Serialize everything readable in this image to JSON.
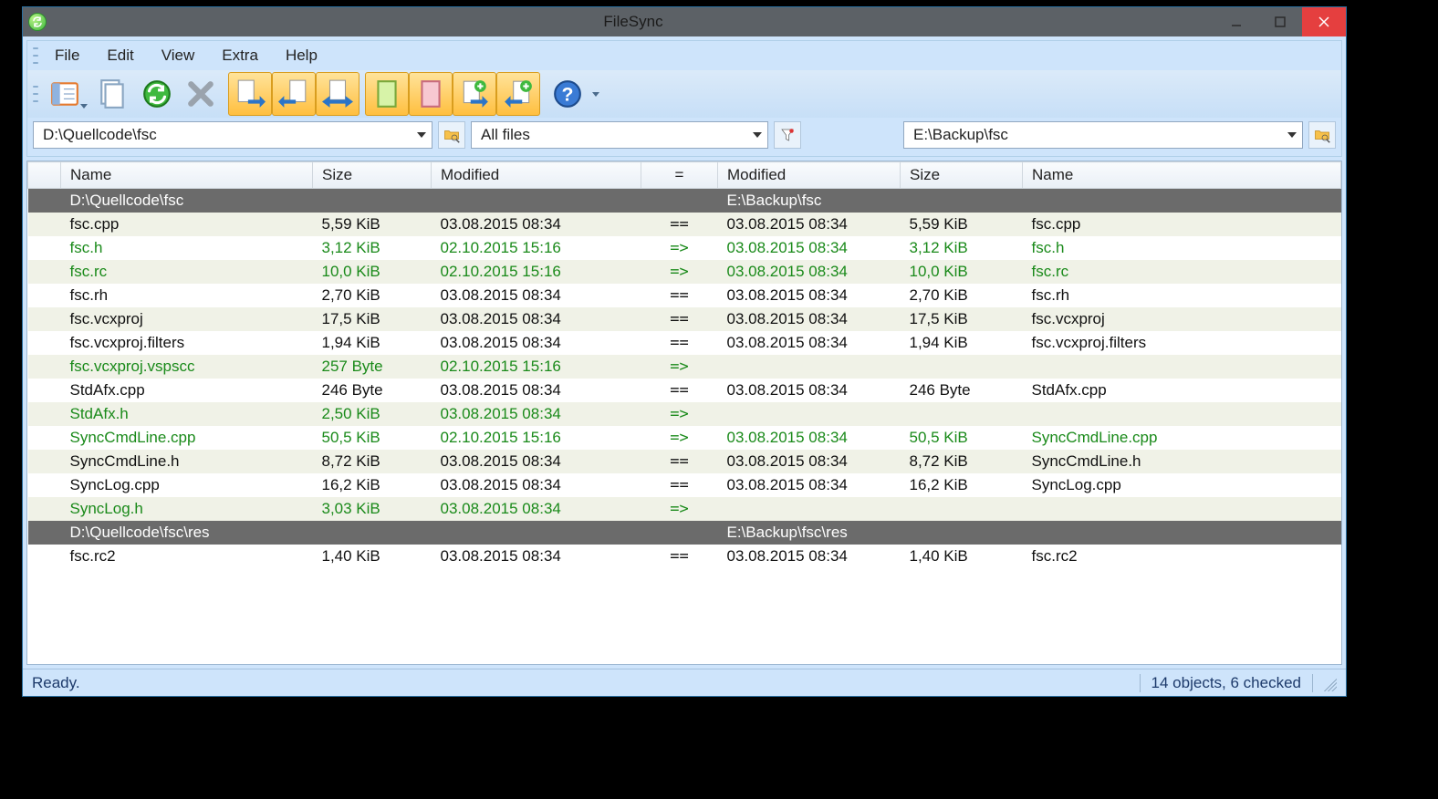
{
  "title": "FileSync",
  "menu": {
    "file": "File",
    "edit": "Edit",
    "view": "View",
    "extra": "Extra",
    "help": "Help"
  },
  "paths": {
    "left": "D:\\Quellcode\\fsc",
    "filter": "All files",
    "right": "E:\\Backup\\fsc"
  },
  "columns": {
    "name_l": "Name",
    "size_l": "Size",
    "mod_l": "Modified",
    "eq": "=",
    "mod_r": "Modified",
    "size_r": "Size",
    "name_r": "Name"
  },
  "rows": [
    {
      "type": "folder",
      "name_l": "D:\\Quellcode\\fsc",
      "name_r": "E:\\Backup\\fsc"
    },
    {
      "type": "file",
      "c": "black",
      "name_l": "fsc.cpp",
      "size_l": "5,59 KiB",
      "mod_l": "03.08.2015  08:34",
      "eq": "==",
      "mod_r": "03.08.2015  08:34",
      "size_r": "5,59 KiB",
      "name_r": "fsc.cpp"
    },
    {
      "type": "file",
      "c": "green",
      "name_l": "fsc.h",
      "size_l": "3,12 KiB",
      "mod_l": "02.10.2015  15:16",
      "eq": "=>",
      "mod_r": "03.08.2015  08:34",
      "size_r": "3,12 KiB",
      "name_r": "fsc.h"
    },
    {
      "type": "file",
      "c": "green",
      "name_l": "fsc.rc",
      "size_l": "10,0 KiB",
      "mod_l": "02.10.2015  15:16",
      "eq": "=>",
      "mod_r": "03.08.2015  08:34",
      "size_r": "10,0 KiB",
      "name_r": "fsc.rc"
    },
    {
      "type": "file",
      "c": "black",
      "name_l": "fsc.rh",
      "size_l": "2,70 KiB",
      "mod_l": "03.08.2015  08:34",
      "eq": "==",
      "mod_r": "03.08.2015  08:34",
      "size_r": "2,70 KiB",
      "name_r": "fsc.rh"
    },
    {
      "type": "file",
      "c": "black",
      "name_l": "fsc.vcxproj",
      "size_l": "17,5 KiB",
      "mod_l": "03.08.2015  08:34",
      "eq": "==",
      "mod_r": "03.08.2015  08:34",
      "size_r": "17,5 KiB",
      "name_r": "fsc.vcxproj"
    },
    {
      "type": "file",
      "c": "black",
      "name_l": "fsc.vcxproj.filters",
      "size_l": "1,94 KiB",
      "mod_l": "03.08.2015  08:34",
      "eq": "==",
      "mod_r": "03.08.2015  08:34",
      "size_r": "1,94 KiB",
      "name_r": "fsc.vcxproj.filters"
    },
    {
      "type": "file",
      "c": "green",
      "name_l": "fsc.vcxproj.vspscc",
      "size_l": "257 Byte",
      "mod_l": "02.10.2015  15:16",
      "eq": "=>",
      "mod_r": "",
      "size_r": "",
      "name_r": ""
    },
    {
      "type": "file",
      "c": "black",
      "name_l": "StdAfx.cpp",
      "size_l": "246 Byte",
      "mod_l": "03.08.2015  08:34",
      "eq": "==",
      "mod_r": "03.08.2015  08:34",
      "size_r": "246 Byte",
      "name_r": "StdAfx.cpp"
    },
    {
      "type": "file",
      "c": "green",
      "name_l": "StdAfx.h",
      "size_l": "2,50 KiB",
      "mod_l": "03.08.2015  08:34",
      "eq": "=>",
      "mod_r": "",
      "size_r": "",
      "name_r": ""
    },
    {
      "type": "file",
      "c": "green",
      "name_l": "SyncCmdLine.cpp",
      "size_l": "50,5 KiB",
      "mod_l": "02.10.2015  15:16",
      "eq": "=>",
      "mod_r": "03.08.2015  08:34",
      "size_r": "50,5 KiB",
      "name_r": "SyncCmdLine.cpp"
    },
    {
      "type": "file",
      "c": "black",
      "name_l": "SyncCmdLine.h",
      "size_l": "8,72 KiB",
      "mod_l": "03.08.2015  08:34",
      "eq": "==",
      "mod_r": "03.08.2015  08:34",
      "size_r": "8,72 KiB",
      "name_r": "SyncCmdLine.h"
    },
    {
      "type": "file",
      "c": "black",
      "name_l": "SyncLog.cpp",
      "size_l": "16,2 KiB",
      "mod_l": "03.08.2015  08:34",
      "eq": "==",
      "mod_r": "03.08.2015  08:34",
      "size_r": "16,2 KiB",
      "name_r": "SyncLog.cpp"
    },
    {
      "type": "file",
      "c": "green",
      "name_l": "SyncLog.h",
      "size_l": "3,03 KiB",
      "mod_l": "03.08.2015  08:34",
      "eq": "=>",
      "mod_r": "",
      "size_r": "",
      "name_r": ""
    },
    {
      "type": "folder",
      "name_l": "D:\\Quellcode\\fsc\\res",
      "name_r": "E:\\Backup\\fsc\\res"
    },
    {
      "type": "file",
      "c": "black",
      "name_l": "fsc.rc2",
      "size_l": "1,40 KiB",
      "mod_l": "03.08.2015  08:34",
      "eq": "==",
      "mod_r": "03.08.2015  08:34",
      "size_r": "1,40 KiB",
      "name_r": "fsc.rc2"
    }
  ],
  "status": {
    "left": "Ready.",
    "right": "14 objects, 6 checked"
  }
}
